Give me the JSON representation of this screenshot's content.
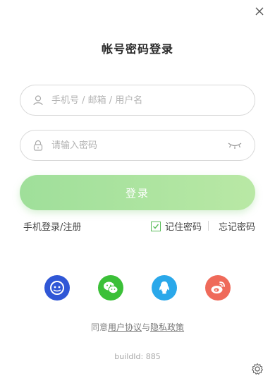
{
  "title": "帐号密码登录",
  "username": {
    "placeholder": "手机号 / 邮箱 / 用户名",
    "value": ""
  },
  "password": {
    "placeholder": "请输入密码",
    "value": ""
  },
  "login_button": "登录",
  "phone_login": "手机登录/注册",
  "remember_label": "记住密码",
  "remember_checked": true,
  "forgot_label": "忘记密码",
  "social_icons": [
    "pp-icon",
    "wechat-icon",
    "qq-icon",
    "weibo-icon"
  ],
  "agreement": {
    "prefix": "同意",
    "user_agreement": "用户协议",
    "and": "与",
    "privacy": "隐私政策"
  },
  "build_id": "buildId: 885",
  "colors": {
    "accent_green": "#9fdf9a",
    "pp_blue": "#3057d6",
    "wechat_green": "#3bc038",
    "qq_blue": "#2aa8ea",
    "weibo_red": "#ef6a5a"
  }
}
